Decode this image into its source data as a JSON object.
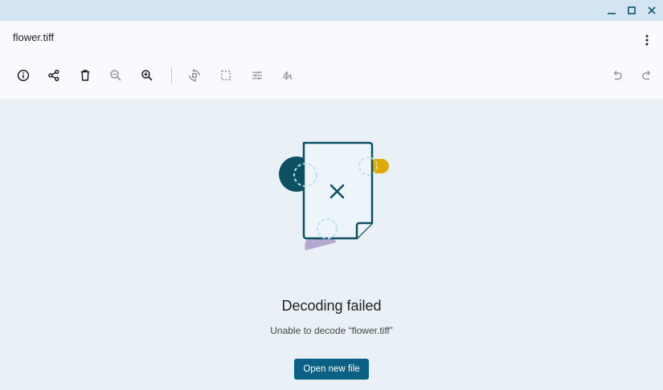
{
  "window": {
    "minimize_icon": "minimize-icon",
    "maximize_icon": "maximize-icon",
    "close_icon": "close-icon"
  },
  "header": {
    "title": "flower.tiff",
    "more_icon": "more-vert-icon"
  },
  "toolbar": {
    "items": [
      {
        "name": "info",
        "icon": "info-icon",
        "enabled": true
      },
      {
        "name": "share",
        "icon": "share-icon",
        "enabled": true
      },
      {
        "name": "delete",
        "icon": "delete-icon",
        "enabled": true
      },
      {
        "name": "zoom-out",
        "icon": "zoom-out-icon",
        "enabled": false
      },
      {
        "name": "zoom-in",
        "icon": "zoom-in-icon",
        "enabled": true
      },
      {
        "name": "rotate",
        "icon": "rotate-icon",
        "enabled": false
      },
      {
        "name": "crop",
        "icon": "crop-icon",
        "enabled": false
      },
      {
        "name": "adjust",
        "icon": "tune-icon",
        "enabled": false
      },
      {
        "name": "annotate",
        "icon": "annotate-icon",
        "enabled": false
      },
      {
        "name": "undo",
        "icon": "undo-icon",
        "enabled": false
      },
      {
        "name": "redo",
        "icon": "redo-icon",
        "enabled": false
      }
    ]
  },
  "error": {
    "title": "Decoding failed",
    "message": "Unable to decode “flower.tiff”",
    "button_label": "Open new file"
  },
  "colors": {
    "background": "#e9f1f7",
    "titlebar": "#d3e5f2",
    "header": "#f8fafd",
    "accent": "#0b6185",
    "illustration_dark": "#0d4f63",
    "illustration_yellow": "#e0a900",
    "illustration_purple": "#b4a8d3",
    "illustration_dash": "#b9dff2"
  }
}
